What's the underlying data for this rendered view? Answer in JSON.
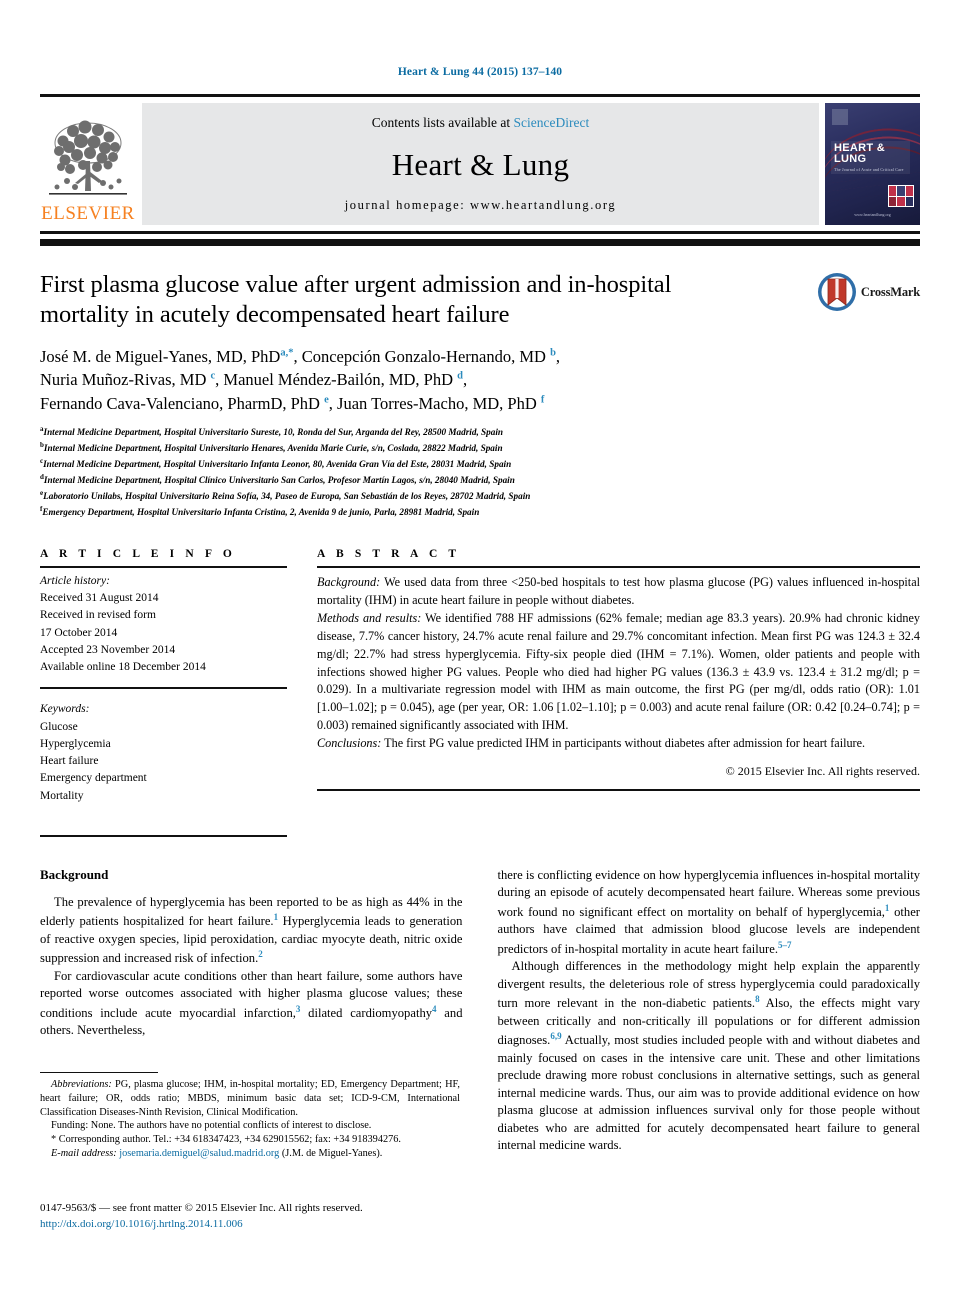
{
  "running_head": "Heart & Lung 44 (2015) 137–140",
  "masthead": {
    "contents_prefix": "Contents lists available at ",
    "sciencedirect": "ScienceDirect",
    "journal_title": "Heart & Lung",
    "homepage": "journal homepage: www.heartandlung.org",
    "publisher_word": "ELSEVIER",
    "cover_title": "HEART & LUNG",
    "cover_subtitle": "The Journal of Acute and Critical Care",
    "cover_url": "www.heartandlung.org"
  },
  "crossmark": {
    "label": "CrossMark",
    "icon": "crossmark-icon"
  },
  "article": {
    "title": "First plasma glucose value after urgent admission and in-hospital mortality in acutely decompensated heart failure",
    "authors_html": "José M. de Miguel-Yanes, MD, PhD|a,*|, Concepción Gonzalo-Hernando, MD|b|, Nuria Muñoz-Rivas, MD|c|, Manuel Méndez-Bailón, MD, PhD|d|, Fernando Cava-Valenciano, PharmD, PhD|e|, Juan Torres-Macho, MD, PhD|f|",
    "authors_lines": [
      "José M. de Miguel-Yanes, MD, PhD a,*, Concepción Gonzalo-Hernando, MD b,",
      "Nuria Muñoz-Rivas, MD c, Manuel Méndez-Bailón, MD, PhD d,",
      "Fernando Cava-Valenciano, PharmD, PhD e, Juan Torres-Macho, MD, PhD f"
    ],
    "affiliations": [
      {
        "mark": "a",
        "text": "Internal Medicine Department, Hospital Universitario Sureste, 10, Ronda del Sur, Arganda del Rey, 28500 Madrid, Spain"
      },
      {
        "mark": "b",
        "text": "Internal Medicine Department, Hospital Universitario Henares, Avenida Marie Curie, s/n, Coslada, 28822 Madrid, Spain"
      },
      {
        "mark": "c",
        "text": "Internal Medicine Department, Hospital Universitario Infanta Leonor, 80, Avenida Gran Vía del Este, 28031 Madrid, Spain"
      },
      {
        "mark": "d",
        "text": "Internal Medicine Department, Hospital Clínico Universitario San Carlos, Profesor Martín Lagos, s/n, 28040 Madrid, Spain"
      },
      {
        "mark": "e",
        "text": "Laboratorio Unilabs, Hospital Universitario Reina Sofía, 34, Paseo de Europa, San Sebastián de los Reyes, 28702 Madrid, Spain"
      },
      {
        "mark": "f",
        "text": "Emergency Department, Hospital Universitario Infanta Cristina, 2, Avenida 9 de junio, Parla, 28981 Madrid, Spain"
      }
    ]
  },
  "article_info": {
    "heading": "A R T I C L E   I N F O",
    "history_label": "Article history:",
    "history": [
      "Received 31 August 2014",
      "Received in revised form",
      "17 October 2014",
      "Accepted 23 November 2014",
      "Available online 18 December 2014"
    ],
    "keywords_label": "Keywords:",
    "keywords": [
      "Glucose",
      "Hyperglycemia",
      "Heart failure",
      "Emergency department",
      "Mortality"
    ]
  },
  "abstract": {
    "heading": "A B S T R A C T",
    "background_label": "Background:",
    "background_text": " We used data from three <250-bed hospitals to test how plasma glucose (PG) values influenced in-hospital mortality (IHM) in acute heart failure in people without diabetes.",
    "methods_label": "Methods and results:",
    "methods_text": " We identified 788 HF admissions (62% female; median age 83.3 years). 20.9% had chronic kidney disease, 7.7% cancer history, 24.7% acute renal failure and 29.7% concomitant infection. Mean first PG was 124.3 ± 32.4 mg/dl; 22.7% had stress hyperglycemia. Fifty-six people died (IHM = 7.1%). Women, older patients and people with infections showed higher PG values. People who died had higher PG values (136.3 ± 43.9 vs. 123.4 ± 31.2 mg/dl; p = 0.029). In a multivariate regression model with IHM as main outcome, the first PG (per mg/dl, odds ratio (OR): 1.01 [1.00–1.02]; p = 0.045), age (per year, OR: 1.06 [1.02–1.10]; p = 0.003) and acute renal failure (OR: 0.42 [0.24–0.74]; p = 0.003) remained significantly associated with IHM.",
    "conclusions_label": "Conclusions:",
    "conclusions_text": " The first PG value predicted IHM in participants without diabetes after admission for heart failure.",
    "copyright": "© 2015 Elsevier Inc. All rights reserved."
  },
  "body": {
    "heading": "Background",
    "left_p1": "The prevalence of hyperglycemia has been reported to be as high as 44% in the elderly patients hospitalized for heart failure.|1| Hyperglycemia leads to generation of reactive oxygen species, lipid peroxidation, cardiac myocyte death, nitric oxide suppression and increased risk of infection.|2|",
    "left_p2": "For cardiovascular acute conditions other than heart failure, some authors have reported worse outcomes associated with higher plasma glucose values; these conditions include acute myocardial infarction,|3| dilated cardiomyopathy|4| and others. Nevertheless,",
    "right_p1": "there is conflicting evidence on how hyperglycemia influences in-hospital mortality during an episode of acutely decompensated heart failure. Whereas some previous work found no significant effect on mortality on behalf of hyperglycemia,|1| other authors have claimed that admission blood glucose levels are independent predictors of in-hospital mortality in acute heart failure.|5–7|",
    "right_p2": "Although differences in the methodology might help explain the apparently divergent results, the deleterious role of stress hyperglycemia could paradoxically turn more relevant in the non-diabetic patients.|8| Also, the effects might vary between critically and non-critically ill populations or for different admission diagnoses.|6,9| Actually, most studies included people with and without diabetes and mainly focused on cases in the intensive care unit. These and other limitations preclude drawing more robust conclusions in alternative settings, such as general internal medicine wards. Thus, our aim was to provide additional evidence on how plasma glucose at admission influences survival only for those people without diabetes who are admitted for acutely decompensated heart failure to general internal medicine wards."
  },
  "footnotes": {
    "abbreviations_label": "Abbreviations:",
    "abbreviations_text": " PG, plasma glucose; IHM, in-hospital mortality; ED, Emergency Department; HF, heart failure; OR, odds ratio; MBDS, minimum basic data set; ICD-9-CM, International Classification Diseases-Ninth Revision, Clinical Modification.",
    "funding": "Funding: None. The authors have no potential conflicts of interest to disclose.",
    "corresponding": "* Corresponding author. Tel.: +34 618347423, +34 629015562; fax: +34 918394276.",
    "email_label": "E-mail address:",
    "email": "josemaria.demiguel@salud.madrid.org",
    "email_suffix": " (J.M. de Miguel-Yanes)."
  },
  "footer": {
    "issn_line": "0147-9563/$ — see front matter © 2015 Elsevier Inc. All rights reserved.",
    "doi": "http://dx.doi.org/10.1016/j.hrtlng.2014.11.006"
  },
  "colors": {
    "link": "#0b6ba1",
    "sciencedirect": "#2b8bbd",
    "elsevier_orange": "#f68121",
    "rule": "#111111"
  }
}
